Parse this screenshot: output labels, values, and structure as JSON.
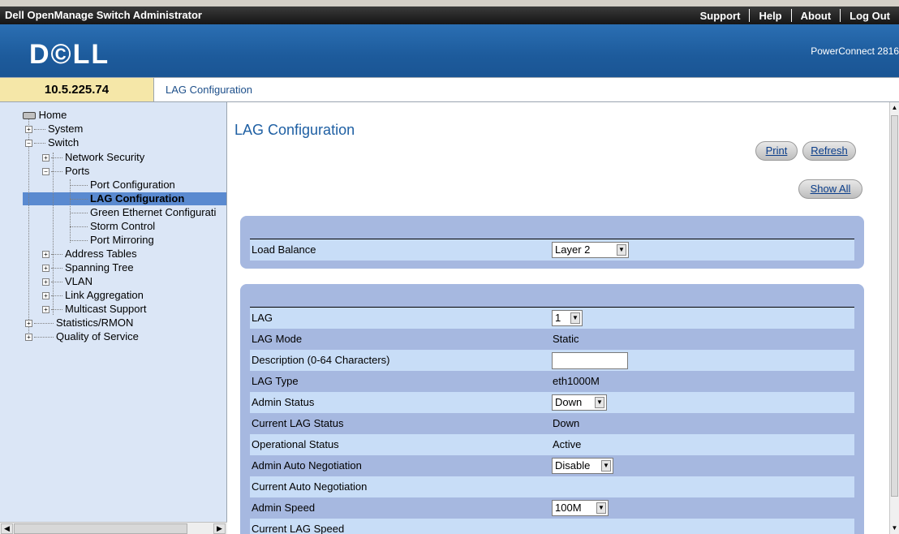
{
  "app": {
    "title": "Dell OpenManage Switch Administrator",
    "links": [
      "Support",
      "Help",
      "About",
      "Log Out"
    ],
    "logo": "D©LL",
    "product": "PowerConnect 2816"
  },
  "address": {
    "ip": "10.5.225.74",
    "crumb": "LAG Configuration"
  },
  "nav": {
    "home": "Home",
    "items": [
      "System",
      "Switch",
      "Network Security",
      "Ports",
      "Port Configuration",
      "LAG Configuration",
      "Green Ethernet Configurati",
      "Storm Control",
      "Port Mirroring",
      "Address Tables",
      "Spanning Tree",
      "VLAN",
      "Link Aggregation",
      "Multicast Support",
      "Statistics/RMON",
      "Quality of Service"
    ]
  },
  "page": {
    "title": "LAG Configuration",
    "print": "Print",
    "refresh": "Refresh",
    "show_all": "Show All"
  },
  "load_balance": {
    "label": "Load Balance",
    "value": "Layer 2"
  },
  "lag": {
    "rows": [
      {
        "label": "LAG",
        "value": "1"
      },
      {
        "label": "LAG Mode",
        "value": "Static"
      },
      {
        "label": "Description (0-64 Characters)",
        "value": ""
      },
      {
        "label": "LAG Type",
        "value": "eth1000M"
      },
      {
        "label": "Admin Status",
        "value": "Down"
      },
      {
        "label": "Current LAG Status",
        "value": "Down"
      },
      {
        "label": "Operational Status",
        "value": "Active"
      },
      {
        "label": "Admin Auto Negotiation",
        "value": "Disable"
      },
      {
        "label": "Current Auto Negotiation",
        "value": ""
      },
      {
        "label": "Admin Speed",
        "value": "100M"
      },
      {
        "label": "Current LAG Speed",
        "value": ""
      }
    ]
  }
}
